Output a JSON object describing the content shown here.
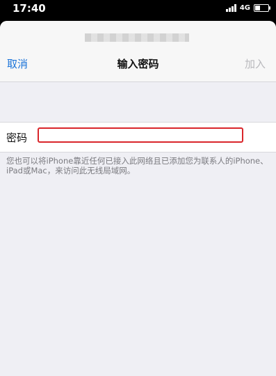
{
  "status_bar": {
    "time": "17:40",
    "network": "4G"
  },
  "nav": {
    "cancel_label": "取消",
    "title": "输入密码",
    "join_label": "加入"
  },
  "password_field": {
    "label": "密码",
    "value": ""
  },
  "hint": "您也可以将iPhone靠近任何已接入此网络且已添加您为联系人的iPhone、iPad或Mac，来访问此无线局域网。",
  "colors": {
    "accent": "#1a73d9",
    "disabled": "#b9b9bd",
    "focus_border": "#d9252a"
  },
  "icons": [
    "signal-icon",
    "battery-icon"
  ]
}
